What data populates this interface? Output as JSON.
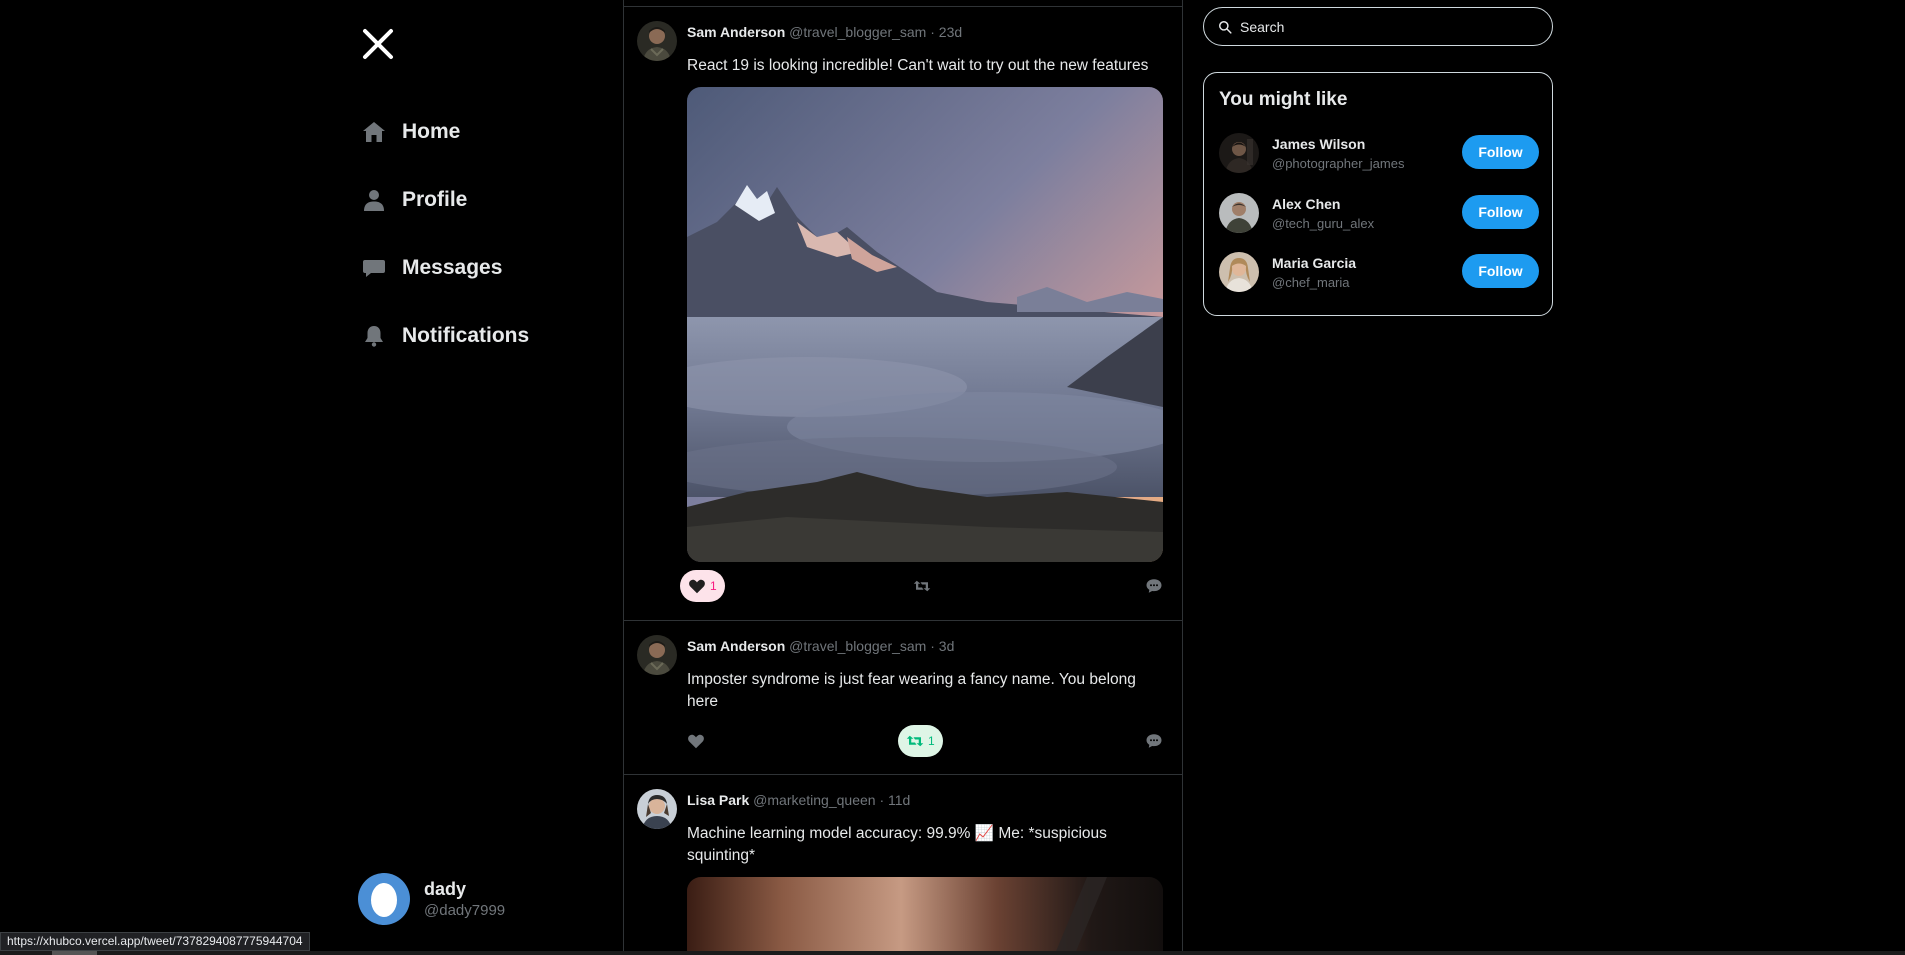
{
  "nav": {
    "items": [
      {
        "label": "Home",
        "icon": "home-icon"
      },
      {
        "label": "Profile",
        "icon": "user-icon"
      },
      {
        "label": "Messages",
        "icon": "message-icon"
      },
      {
        "label": "Notifications",
        "icon": "bell-icon"
      }
    ],
    "logo_icon": "x-logo-icon"
  },
  "account": {
    "name": "dady",
    "handle": "@dady7999"
  },
  "tweets": [
    {
      "name": "Sam Anderson",
      "handle": "@travel_blogger_sam",
      "dot": "·",
      "time": "23d",
      "text": "React 19 is looking incredible! Can't wait to try out the new features",
      "like_count": "1",
      "retweet_count": "",
      "liked": true,
      "retweeted": false
    },
    {
      "name": "Sam Anderson",
      "handle": "@travel_blogger_sam",
      "dot": "·",
      "time": "3d",
      "text": "Imposter syndrome is just fear wearing a fancy name. You belong here",
      "like_count": "",
      "retweet_count": "1",
      "liked": false,
      "retweeted": true
    },
    {
      "name": "Lisa Park",
      "handle": "@marketing_queen",
      "dot": "·",
      "time": "11d",
      "text": "Machine learning model accuracy: 99.9% 📈 Me: *suspicious squinting*"
    }
  ],
  "search": {
    "placeholder": "Search"
  },
  "suggestions": {
    "title": "You might like",
    "users": [
      {
        "name": "James Wilson",
        "handle": "@photographer_james",
        "button": "Follow"
      },
      {
        "name": "Alex Chen",
        "handle": "@tech_guru_alex",
        "button": "Follow"
      },
      {
        "name": "Maria Garcia",
        "handle": "@chef_maria",
        "button": "Follow"
      }
    ]
  },
  "status_url": "https://xhubco.vercel.app/tweet/7378294087775944704",
  "colors": {
    "accent": "#1d9bf0",
    "like": "#f91880",
    "retweet": "#00ba7c",
    "background": "#000000"
  }
}
